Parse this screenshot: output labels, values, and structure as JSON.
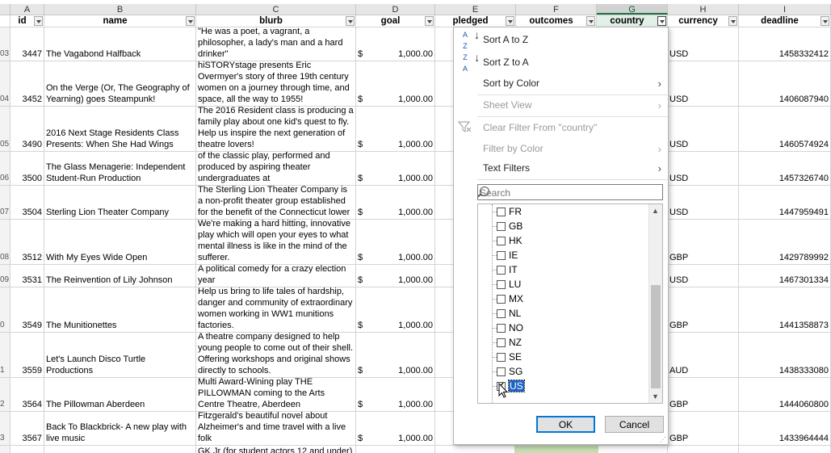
{
  "column_letters": [
    "A",
    "B",
    "C",
    "D",
    "E",
    "F",
    "G",
    "H",
    "I"
  ],
  "selected_column": "G",
  "headers": {
    "id": "id",
    "name": "name",
    "blurb": "blurb",
    "goal": "goal",
    "pledged": "pledged",
    "outcomes": "outcomes",
    "country": "country",
    "currency": "currency",
    "deadline": "deadline"
  },
  "rows": [
    {
      "rn": "03",
      "id": "3447",
      "name": "The Vagabond Halfback",
      "blurb": "\"He was a poet, a vagrant, a philosopher, a lady's man and a hard drinker\"",
      "goal_sym": "$",
      "goal": "1,000.00",
      "currency": "USD",
      "deadline": "1458332412"
    },
    {
      "rn": "04",
      "id": "3452",
      "name": "On the Verge (Or, The Geography of Yearning) goes Steampunk!",
      "blurb": "hiSTORYstage presents Eric Overmyer's story of three 19th century women on a journey through time, and space, all the way to 1955!",
      "goal_sym": "$",
      "goal": "1,000.00",
      "currency": "USD",
      "deadline": "1406087940"
    },
    {
      "rn": "05",
      "id": "3490",
      "name": "2016 Next Stage Residents Class Presents: When She Had Wings",
      "blurb": "The 2016 Resident class is producing a family play about one kid's quest to fly. Help us inspire the next generation of theatre lovers!",
      "goal_sym": "$",
      "goal": "1,000.00",
      "currency": "USD",
      "deadline": "1460574924"
    },
    {
      "rn": "06",
      "id": "3500",
      "name": "The Glass Menagerie: Independent Student-Run Production",
      "blurb": "A minimalist, post-modern production of the classic play, performed and produced by aspiring theater undergraduates at",
      "goal_sym": "$",
      "goal": "1,000.00",
      "currency": "USD",
      "deadline": "1457326740"
    },
    {
      "rn": "07",
      "id": "3504",
      "name": "Sterling Lion Theater Company",
      "blurb": "The Sterling Lion Theater Company is a non-profit theater group established for the benefit of the Connecticut lower",
      "goal_sym": "$",
      "goal": "1,000.00",
      "currency": "USD",
      "deadline": "1447959491"
    },
    {
      "rn": "08",
      "id": "3512",
      "name": "With My Eyes Wide Open",
      "blurb": "We're making a hard hitting, innovative play which will open your eyes to what mental illness is like in the mind of the sufferer.",
      "goal_sym": "$",
      "goal": "1,000.00",
      "currency": "GBP",
      "deadline": "1429789992"
    },
    {
      "rn": "09",
      "id": "3531",
      "name": "The Reinvention of Lily Johnson",
      "blurb": "A political comedy for a crazy election year",
      "goal_sym": "$",
      "goal": "1,000.00",
      "currency": "USD",
      "deadline": "1467301334"
    },
    {
      "rn": "0",
      "id": "3549",
      "name": "The Munitionettes",
      "blurb": "Help us bring to life tales of hardship, danger and community of extraordinary women working in WW1 munitions factories.",
      "goal_sym": "$",
      "goal": "1,000.00",
      "currency": "GBP",
      "deadline": "1441358873"
    },
    {
      "rn": "1",
      "id": "3559",
      "name": "Let's Launch Disco Turtle Productions",
      "blurb": "A theatre company designed to help young people to come out of their shell. Offering workshops and original shows directly to schools.",
      "goal_sym": "$",
      "goal": "1,000.00",
      "currency": "AUD",
      "deadline": "1438333080"
    },
    {
      "rn": "2",
      "id": "3564",
      "name": "The Pillowman Aberdeen",
      "blurb": "Multi Award-Wining play THE PILLOWMAN coming to the Arts Centre Theatre, Aberdeen",
      "goal_sym": "$",
      "goal": "1,000.00",
      "currency": "GBP",
      "deadline": "1444060800"
    },
    {
      "rn": "3",
      "id": "3567",
      "name": "Back To Blackbrick- A new play with live music",
      "blurb": "First stage adaptation of Sarah Moore Fitzgerald's beautiful novel about Alzheimer's and time travel with a live folk",
      "goal_sym": "$",
      "goal": "1,000.00",
      "currency": "GBP",
      "deadline": "1433964444"
    },
    {
      "rn": "",
      "id": "",
      "name": "",
      "blurb": "GK Jr (for student actors 12 and under) will",
      "goal_sym": "",
      "goal": "",
      "currency": "",
      "deadline": ""
    }
  ],
  "filter_menu": {
    "sort_az": "Sort A to Z",
    "sort_za": "Sort Z to A",
    "sort_color": "Sort by Color",
    "sheet_view": "Sheet View",
    "clear_filter": "Clear Filter From \"country\"",
    "filter_color": "Filter by Color",
    "text_filters": "Text Filters",
    "search_placeholder": "Search",
    "items": [
      {
        "label": "FR",
        "checked": false
      },
      {
        "label": "GB",
        "checked": false
      },
      {
        "label": "HK",
        "checked": false
      },
      {
        "label": "IE",
        "checked": false
      },
      {
        "label": "IT",
        "checked": false
      },
      {
        "label": "LU",
        "checked": false
      },
      {
        "label": "MX",
        "checked": false
      },
      {
        "label": "NL",
        "checked": false
      },
      {
        "label": "NO",
        "checked": false
      },
      {
        "label": "NZ",
        "checked": false
      },
      {
        "label": "SE",
        "checked": false
      },
      {
        "label": "SG",
        "checked": false
      },
      {
        "label": "US",
        "checked": true
      }
    ],
    "ok": "OK",
    "cancel": "Cancel"
  }
}
